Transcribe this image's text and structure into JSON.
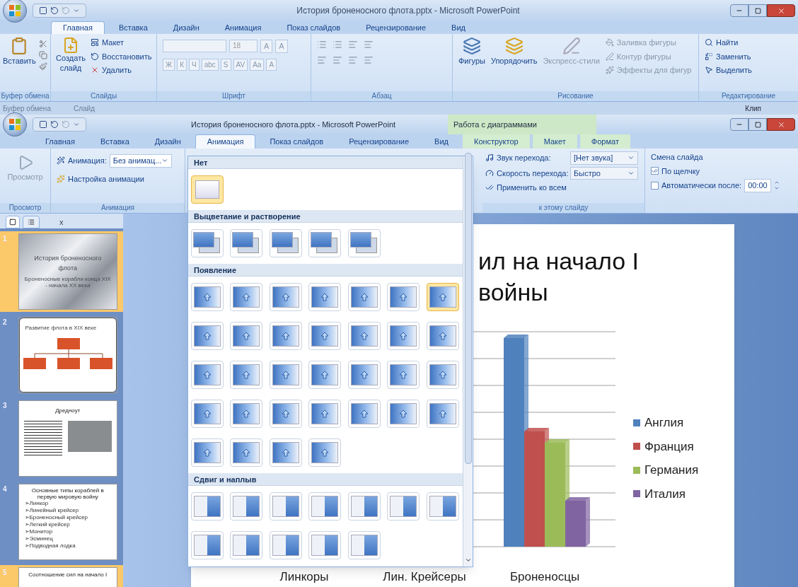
{
  "back_window": {
    "title": "История броненосного флота.pptx - Microsoft PowerPoint",
    "tabs": [
      {
        "label": "Главная",
        "selected": true
      },
      {
        "label": "Вставка",
        "selected": false
      },
      {
        "label": "Дизайн",
        "selected": false
      },
      {
        "label": "Анимация",
        "selected": false
      },
      {
        "label": "Показ слайдов",
        "selected": false
      },
      {
        "label": "Рецензирование",
        "selected": false
      },
      {
        "label": "Вид",
        "selected": false
      }
    ],
    "ribbon": {
      "clipboard": {
        "paste": "Вставить",
        "group": "Буфер обмена"
      },
      "slides": {
        "new": "Создать слайд",
        "layout": "Макет",
        "reset": "Восстановить",
        "delete": "Удалить",
        "group": "Слайды"
      },
      "font": {
        "size": "18",
        "grow": [
          "A",
          "A"
        ],
        "buttons": [
          "Ж",
          "К",
          "Ч",
          "abc",
          "S",
          "AV",
          "Aa",
          "A"
        ],
        "group": "Шрифт"
      },
      "paragraph": {
        "group": "Абзац"
      },
      "drawing": {
        "shapes": "Фигуры",
        "arrange": "Упорядочить",
        "styles": "Экспресс-стили",
        "fill": "Заливка фигуры",
        "outline": "Контур фигуры",
        "effects": "Эффекты для фигур",
        "group": "Рисование"
      },
      "editing": {
        "find": "Найти",
        "replace": "Заменить",
        "select": "Выделить",
        "group": "Редактирование"
      }
    },
    "strip": {
      "label": "Буфер обмена",
      "tab": "Слайд",
      "pane": "Клип"
    }
  },
  "front_window": {
    "title": "История броненосного флота.pptx - Microsoft PowerPoint",
    "context": "Работа с диаграммами",
    "tabs": [
      {
        "label": "Главная",
        "selected": false,
        "kind": "main"
      },
      {
        "label": "Вставка",
        "selected": false,
        "kind": "main"
      },
      {
        "label": "Дизайн",
        "selected": false,
        "kind": "main"
      },
      {
        "label": "Анимация",
        "selected": true,
        "kind": "main"
      },
      {
        "label": "Показ слайдов",
        "selected": false,
        "kind": "main"
      },
      {
        "label": "Рецензирование",
        "selected": false,
        "kind": "main"
      },
      {
        "label": "Вид",
        "selected": false,
        "kind": "main"
      },
      {
        "label": "Конструктор",
        "selected": false,
        "kind": "context"
      },
      {
        "label": "Макет",
        "selected": false,
        "kind": "context"
      },
      {
        "label": "Формат",
        "selected": false,
        "kind": "context"
      }
    ],
    "preview": {
      "button": "Просмотр",
      "group": "Просмотр"
    },
    "animation": {
      "label": "Анимация:",
      "value": "Без анимац...",
      "custom": "Настройка анимации",
      "group": "Анимация"
    },
    "transition": {
      "sound_label": "Звук перехода:",
      "sound_value": "[Нет звука]",
      "speed_label": "Скорость перехода:",
      "speed_value": "Быстро",
      "apply": "Применить ко всем",
      "group": "к этому слайду"
    },
    "advance": {
      "header": "Смена слайда",
      "on_click": {
        "label": "По щелчку",
        "checked": true
      },
      "auto": {
        "label": "Автоматически после:",
        "checked": false,
        "value": "00:00"
      }
    }
  },
  "slides_panel": {
    "close": "x",
    "slides": [
      {
        "number": "1",
        "selected": true,
        "kind": "title",
        "title": "История броненосного флота",
        "subtitle": "Броненосные корабли конца XIX - начала XX века"
      },
      {
        "number": "2",
        "selected": false,
        "kind": "diagram",
        "title": "Развитие флота в XIX веке"
      },
      {
        "number": "3",
        "selected": false,
        "kind": "text_photo",
        "title": "Дредноут"
      },
      {
        "number": "4",
        "selected": false,
        "kind": "bullets",
        "title": "Основные типы кораблей в первую мировую войну",
        "bullets": [
          "➢Линкор",
          "➢Линейный крейсер",
          "➢Броненосный крейсер",
          "➢Легкий крейсер",
          "➢Монитор",
          "➢Эсминец",
          "➢Подводная лодка"
        ]
      },
      {
        "number": "5",
        "selected": true,
        "kind": "title_only",
        "title": "Соотношение сил на начало I"
      }
    ]
  },
  "gallery": {
    "sections": [
      {
        "title": "Нет",
        "kind": "none",
        "items": [
          {
            "selected": true
          }
        ]
      },
      {
        "title": "Выцветание и растворение",
        "kind": "fade",
        "items": [
          {
            "selected": false
          },
          {
            "selected": false
          },
          {
            "selected": false
          },
          {
            "selected": false
          },
          {
            "selected": false
          }
        ]
      },
      {
        "title": "Появление",
        "kind": "reveal",
        "items": [
          {
            "selected": false
          },
          {
            "selected": false
          },
          {
            "selected": false
          },
          {
            "selected": false
          },
          {
            "selected": false
          },
          {
            "selected": false
          },
          {
            "selected": true
          },
          {
            "selected": false
          },
          {
            "selected": false
          },
          {
            "selected": false
          },
          {
            "selected": false
          },
          {
            "selected": false
          },
          {
            "selected": false
          },
          {
            "selected": false
          },
          {
            "selected": false
          },
          {
            "selected": false
          },
          {
            "selected": false
          },
          {
            "selected": false
          },
          {
            "selected": false
          },
          {
            "selected": false
          },
          {
            "selected": false
          },
          {
            "selected": false
          },
          {
            "selected": false
          },
          {
            "selected": false
          },
          {
            "selected": false
          },
          {
            "selected": false
          },
          {
            "selected": false
          },
          {
            "selected": false
          },
          {
            "selected": false
          },
          {
            "selected": false
          },
          {
            "selected": false
          },
          {
            "selected": false
          }
        ]
      },
      {
        "title": "Сдвиг и наплыв",
        "kind": "push",
        "items": [
          {
            "selected": false
          },
          {
            "selected": false
          },
          {
            "selected": false
          },
          {
            "selected": false
          },
          {
            "selected": false
          },
          {
            "selected": false
          },
          {
            "selected": false
          },
          {
            "selected": false
          },
          {
            "selected": false
          },
          {
            "selected": false
          },
          {
            "selected": false
          },
          {
            "selected": false
          }
        ]
      }
    ]
  },
  "slide": {
    "title_lines": [
      "ил на начало I",
      "войны"
    ],
    "categories": [
      "Линкоры",
      "Лин. Крейсеры",
      "Броненосцы"
    ],
    "legend": [
      {
        "name": "Англия",
        "color": "#4f81bd"
      },
      {
        "name": "Франция",
        "color": "#c0504d"
      },
      {
        "name": "Германия",
        "color": "#9bbb59"
      },
      {
        "name": "Италия",
        "color": "#8064a2"
      }
    ]
  }
}
